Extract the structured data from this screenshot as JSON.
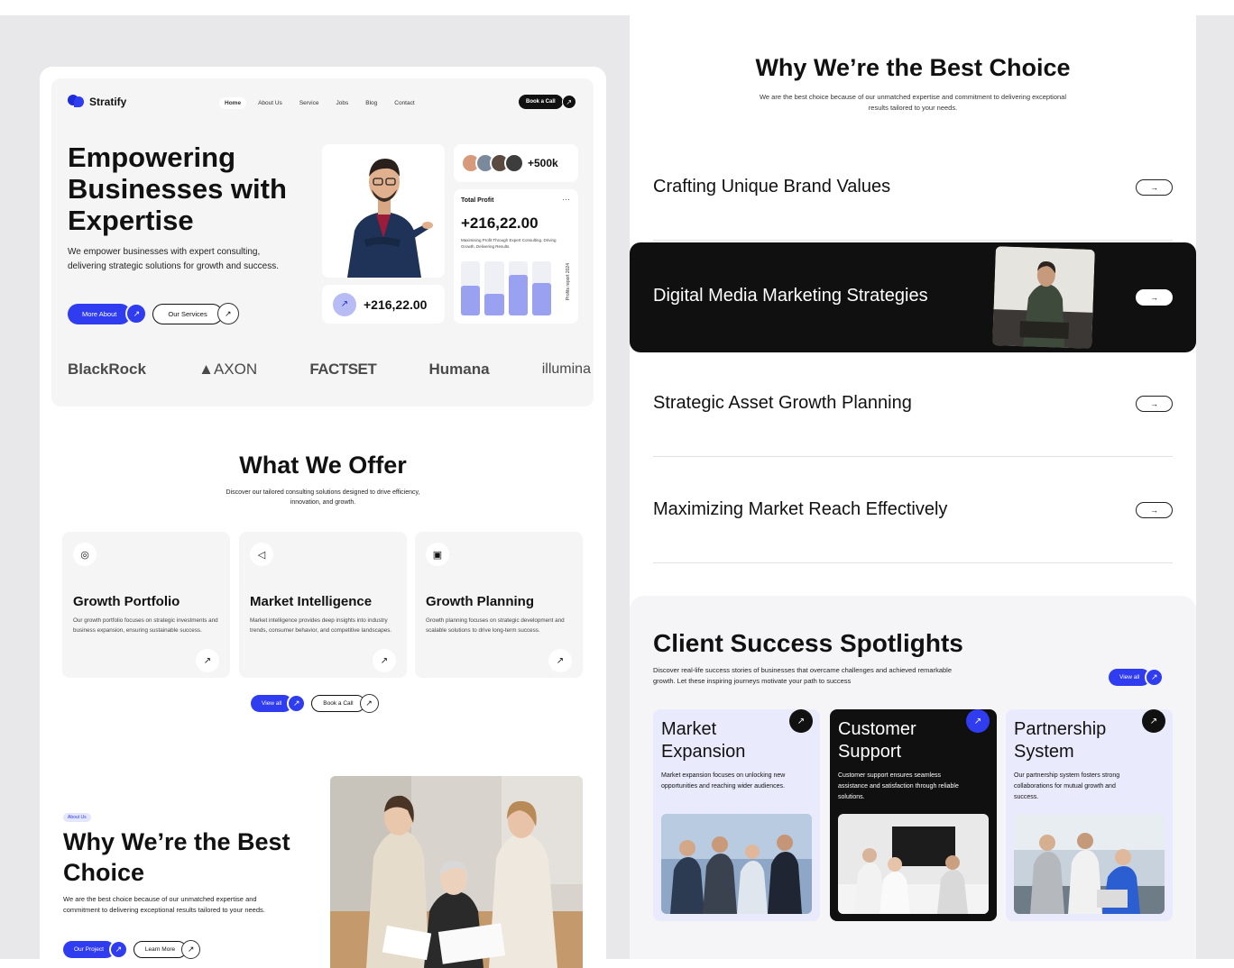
{
  "left": {
    "brand": "Stratify",
    "nav": [
      "Home",
      "About Us",
      "Service",
      "Jobs",
      "Blog",
      "Contact"
    ],
    "book_call": "Book a Call",
    "hero_title": "Empowering Businesses with Expertise",
    "hero_desc": "We empower businesses with expert consulting, delivering strategic solutions for growth and success.",
    "more_about": "More About",
    "our_services": "Our Services",
    "avatars_count": "+500k",
    "profit": {
      "label": "Total Profit",
      "value": "+216,22.00",
      "sub": "Maximising Profit Through Expert Consulting. Driving Growth, Delivering Results.",
      "vertical_label": "Profits report 2024",
      "bars": [
        0.55,
        0.4,
        0.75,
        0.6
      ]
    },
    "stat_value": "+216,22.00",
    "brands": [
      "BlackRock",
      "AXON",
      "FACTSET",
      "Humana",
      "illumina"
    ],
    "offer": {
      "title": "What We Offer",
      "desc": "Discover our tailored consulting solutions designed to drive efficiency, innovation, and growth.",
      "cards": [
        {
          "title": "Growth Portfolio",
          "desc": "Our growth portfolio focuses on strategic investments and business expansion, ensuring sustainable success.",
          "icon": "user-circle-icon"
        },
        {
          "title": "Market Intelligence",
          "desc": "Market intelligence provides deep insights into industry trends, consumer behavior, and competitive landscapes.",
          "icon": "megaphone-icon"
        },
        {
          "title": "Growth Planning",
          "desc": "Growth planning focuses on strategic development and scalable solutions to drive long-term success.",
          "icon": "chart-icon"
        }
      ],
      "view_all": "View all",
      "book_call": "Book a Call"
    },
    "why": {
      "tag": "About Us",
      "title": "Why We’re the Best Choice",
      "desc": "We are the best choice because of our unmatched expertise and commitment to delivering exceptional results tailored to your needs.",
      "our_project": "Our Project",
      "learn_more": "Learn More"
    }
  },
  "right": {
    "title": "Why We’re the Best Choice",
    "desc": "We are the best choice because of our unmatched expertise and commitment to delivering exceptional results tailored to your needs.",
    "choices": [
      "Crafting Unique Brand Values",
      "Digital Media Marketing Strategies",
      "Strategic Asset Growth Planning",
      "Maximizing Market Reach Effectively"
    ],
    "spotlight": {
      "title": "Client Success Spotlights",
      "desc": "Discover real-life success stories of businesses that overcame challenges and achieved remarkable growth. Let these inspiring journeys motivate your path to success",
      "view_all": "View all",
      "cards": [
        {
          "title": "Market Expansion",
          "desc": "Market expansion focuses on unlocking new opportunities and reaching wider audiences."
        },
        {
          "title": "Customer Support",
          "desc": "Customer support ensures seamless assistance and satisfaction through reliable solutions."
        },
        {
          "title": "Partnership System",
          "desc": "Our partnership system fosters strong collaborations for mutual growth and success."
        }
      ]
    }
  },
  "colors": {
    "accent": "#2f3cf0",
    "dark": "#101010",
    "soft_blue": "#e9ebfd"
  }
}
